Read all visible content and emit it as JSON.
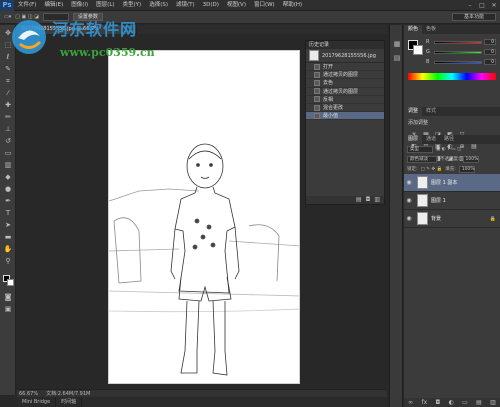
{
  "app": {
    "logo": "Ps"
  },
  "menu": [
    "文件(F)",
    "编辑(E)",
    "图像(I)",
    "图层(L)",
    "类型(Y)",
    "选择(S)",
    "滤镜(T)",
    "3D(D)",
    "视图(V)",
    "窗口(W)",
    "帮助(H)"
  ],
  "window_controls": [
    "–",
    "□",
    "✕"
  ],
  "options": {
    "field1": "",
    "button": "设置参数",
    "workspace": "基本功能"
  },
  "document": {
    "tab": "20179828155556.jpg @ 66.7%",
    "zoom": "66.67%",
    "doc_info": "文档:2.64M/7.91M"
  },
  "bottom_tabs": [
    "Mini Bridge",
    "时间轴"
  ],
  "history": {
    "title": "历史记录",
    "snapshot": "20179628155556.jpg",
    "items": [
      {
        "label": "打开",
        "active": false
      },
      {
        "label": "通过拷贝的图层",
        "active": false
      },
      {
        "label": "去色",
        "active": false
      },
      {
        "label": "通过拷贝的图层",
        "active": false
      },
      {
        "label": "反相",
        "active": false
      },
      {
        "label": "混合更改",
        "active": false
      },
      {
        "label": "最小值",
        "active": true
      }
    ]
  },
  "color_panel": {
    "tabs": [
      "颜色",
      "色板"
    ],
    "rows": [
      {
        "label": "R",
        "value": "0",
        "color": "#ff2b2b"
      },
      {
        "label": "G",
        "value": "0",
        "color": "#2bff2b"
      },
      {
        "label": "B",
        "value": "0",
        "color": "#2b5bff"
      }
    ]
  },
  "adjust_panel": {
    "tabs": [
      "调整",
      "样式"
    ],
    "title": "添加调整",
    "icons_row1": [
      "☀",
      "▦",
      "◪",
      "◩",
      "▽"
    ],
    "icons_row2": [
      "◧",
      "⚖",
      "▣",
      "◐",
      "⊕",
      "▤"
    ],
    "icons_row3": [
      "◫",
      "▥",
      "◨",
      "◢",
      "▧"
    ]
  },
  "layers_panel": {
    "tabs": [
      "图层",
      "通道",
      "路径"
    ],
    "kind_label": "类型",
    "blend_mode": "颜色减淡",
    "opacity_label": "不透明度:",
    "opacity_value": "100%",
    "lock_label": "锁定:",
    "fill_label": "填充:",
    "fill_value": "100%",
    "layers": [
      {
        "name": "图层 1 副本",
        "active": true,
        "locked": false
      },
      {
        "name": "图层 1",
        "active": false,
        "locked": false
      },
      {
        "name": "背景",
        "active": false,
        "locked": true
      }
    ]
  },
  "watermark": {
    "title": "河东软件网",
    "url": "www.pc0359.cn"
  }
}
